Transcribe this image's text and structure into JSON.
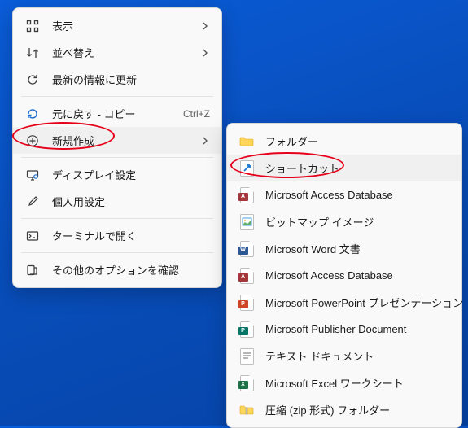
{
  "main_menu": {
    "view": "表示",
    "sort": "並べ替え",
    "refresh": "最新の情報に更新",
    "undo": "元に戻す - コピー",
    "undo_accel": "Ctrl+Z",
    "new": "新規作成",
    "display": "ディスプレイ設定",
    "personalize": "個人用設定",
    "terminal": "ターミナルで開く",
    "more": "その他のオプションを確認"
  },
  "sub_menu": {
    "folder": "フォルダー",
    "shortcut": "ショートカット",
    "access1": "Microsoft Access Database",
    "bitmap": "ビットマップ イメージ",
    "word": "Microsoft Word 文書",
    "access2": "Microsoft Access Database",
    "powerpoint": "Microsoft PowerPoint プレゼンテーション",
    "publisher": "Microsoft Publisher Document",
    "text": "テキスト ドキュメント",
    "excel": "Microsoft Excel ワークシート",
    "zip": "圧縮 (zip 形式) フォルダー"
  },
  "colors": {
    "word": "#2b5797",
    "excel": "#1e7145",
    "powerpoint": "#d04525",
    "access": "#a4373a",
    "publisher": "#077568",
    "folder": "#ffcb4f",
    "shortcut": "#1976d2",
    "zip": "#ffcb4f"
  }
}
